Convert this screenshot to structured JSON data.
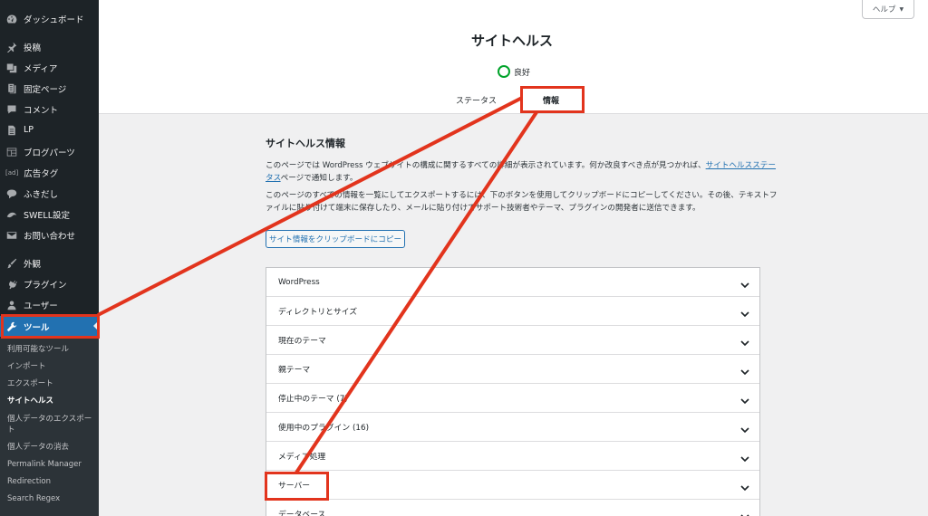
{
  "sidebar": {
    "items": [
      {
        "label": "ダッシュボード",
        "icon": "dashboard-icon"
      },
      {
        "label": "投稿",
        "icon": "pin-icon"
      },
      {
        "label": "メディア",
        "icon": "media-icon"
      },
      {
        "label": "固定ページ",
        "icon": "page-icon"
      },
      {
        "label": "コメント",
        "icon": "comment-icon"
      },
      {
        "label": "LP",
        "icon": "document-icon"
      },
      {
        "label": "ブログパーツ",
        "icon": "layout-icon"
      },
      {
        "label": "広告タグ",
        "icon": "ad-icon"
      },
      {
        "label": "ふきだし",
        "icon": "speech-bubble-icon"
      },
      {
        "label": "SWELL設定",
        "icon": "swell-icon"
      },
      {
        "label": "お問い合わせ",
        "icon": "mail-icon"
      },
      {
        "label": "外観",
        "icon": "brush-icon"
      },
      {
        "label": "プラグイン",
        "icon": "plugin-icon"
      },
      {
        "label": "ユーザー",
        "icon": "user-icon"
      },
      {
        "label": "ツール",
        "icon": "wrench-icon"
      }
    ],
    "ad_icon_text": "[ad]",
    "submenu": [
      "利用可能なツール",
      "インポート",
      "エクスポート",
      "サイトヘルス",
      "個人データのエクスポート",
      "個人データの消去",
      "Permalink Manager",
      "Redirection",
      "Search Regex"
    ]
  },
  "header": {
    "help_label": "ヘルプ",
    "help_caret": "▼",
    "title": "サイトヘルス",
    "status_label": "良好",
    "tabs": [
      "ステータス",
      "情報"
    ]
  },
  "main": {
    "section_title": "サイトヘルス情報",
    "para1_text": "このページでは WordPress ウェブサイトの構成に関するすべての詳細が表示されています。何か改良すべき点が見つかれば、",
    "para1_link": "サイトヘルスステータス",
    "para1_suffix": "ページで通知します。",
    "para2_text": "このページのすべての情報を一覧にしてエクスポートするには、下のボタンを使用してクリップボードにコピーしてください。その後、テキストファイルに貼り付けて端末に保存したり、メールに貼り付けてサポート技術者やテーマ、プラグインの開発者に送信できます。",
    "copy_button": "サイト情報をクリップボードにコピー",
    "accordion": [
      "WordPress",
      "ディレクトリとサイズ",
      "現在のテーマ",
      "親テーマ",
      "停止中のテーマ (7)",
      "使用中のプラグイン (16)",
      "メディア処理",
      "サーバー",
      "データベース"
    ]
  },
  "colors": {
    "sidebar_bg": "#1d2327",
    "accent": "#2271b1",
    "good_status": "#00a32a",
    "annotation_red": "#e2341d"
  }
}
